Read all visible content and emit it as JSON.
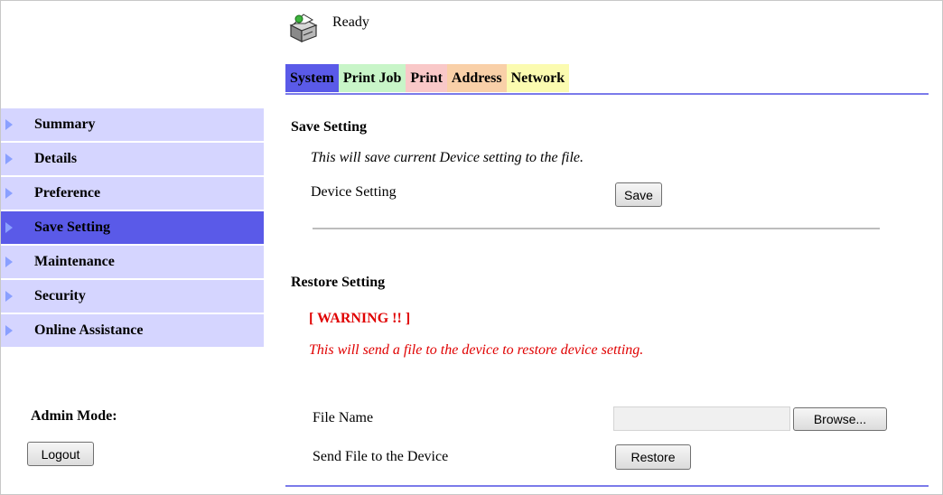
{
  "status": {
    "text": "Ready",
    "icon": "printer-icon"
  },
  "tabs": [
    {
      "label": "System",
      "bg": "#5a5ae8",
      "active": true
    },
    {
      "label": "Print Job",
      "bg": "#c8f5c8",
      "active": false
    },
    {
      "label": "Print",
      "bg": "#f9c8c8",
      "active": false
    },
    {
      "label": "Address",
      "bg": "#f9d0a8",
      "active": false
    },
    {
      "label": "Network",
      "bg": "#fbfbb0",
      "active": false
    }
  ],
  "sidebar": {
    "items": [
      {
        "label": "Summary",
        "selected": false
      },
      {
        "label": "Details",
        "selected": false
      },
      {
        "label": "Preference",
        "selected": false
      },
      {
        "label": "Save Setting",
        "selected": true
      },
      {
        "label": "Maintenance",
        "selected": false
      },
      {
        "label": "Security",
        "selected": false
      },
      {
        "label": "Online Assistance",
        "selected": false
      }
    ],
    "admin_label": "Admin Mode:",
    "logout_label": "Logout"
  },
  "save_section": {
    "title": "Save Setting",
    "description": "This will save current Device setting to the file.",
    "device_label": "Device Setting",
    "save_label": "Save"
  },
  "restore_section": {
    "title": "Restore Setting",
    "warning": "[ WARNING !! ]",
    "description": "This will send a file to the device to restore device setting.",
    "file_label": "File Name",
    "file_value": "",
    "browse_label": "Browse...",
    "send_label": "Send File to the Device",
    "restore_label": "Restore"
  },
  "colors": {
    "tab_rule": "#7b7bea",
    "sidebar_item": "#d5d5ff",
    "sidebar_selected": "#5a5ae8",
    "sidebar_arrow": "#8aa0ff",
    "warning": "#e00000",
    "border": "#c8c8c8"
  }
}
